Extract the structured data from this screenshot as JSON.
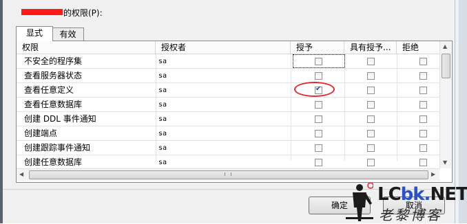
{
  "permissions_label": "的权限(P):",
  "tabs": [
    {
      "label": "显式",
      "active": true
    },
    {
      "label": "有效",
      "active": false
    }
  ],
  "table": {
    "columns": [
      "权限",
      "授权者",
      "授予",
      "具有授予...",
      "拒绝"
    ],
    "rows": [
      {
        "permission": "不安全的程序集",
        "grantor": "sa",
        "grant": false,
        "with_grant": false,
        "deny": false
      },
      {
        "permission": "查看服务器状态",
        "grantor": "sa",
        "grant": false,
        "with_grant": false,
        "deny": false
      },
      {
        "permission": "查看任意定义",
        "grantor": "sa",
        "grant": true,
        "with_grant": false,
        "deny": false
      },
      {
        "permission": "查看任意数据库",
        "grantor": "sa",
        "grant": false,
        "with_grant": false,
        "deny": false
      },
      {
        "permission": "创建 DDL 事件通知",
        "grantor": "sa",
        "grant": false,
        "with_grant": false,
        "deny": false
      },
      {
        "permission": "创建端点",
        "grantor": "sa",
        "grant": false,
        "with_grant": false,
        "deny": false
      },
      {
        "permission": "创建跟踪事件通知",
        "grantor": "sa",
        "grant": false,
        "with_grant": false,
        "deny": false
      },
      {
        "permission": "创建任意数据库",
        "grantor": "sa",
        "grant": false,
        "with_grant": false,
        "deny": false
      }
    ]
  },
  "buttons": {
    "ok": "确定",
    "cancel": "取消"
  },
  "watermark": {
    "url_prefix": "LC",
    "url_mid": "bk.",
    "url_suffix": "NET",
    "subtitle": "老黎博客"
  },
  "colors": {
    "annotation": "#e8262b",
    "redaction": "#ff1a1a",
    "accent": "#2a52c8"
  }
}
